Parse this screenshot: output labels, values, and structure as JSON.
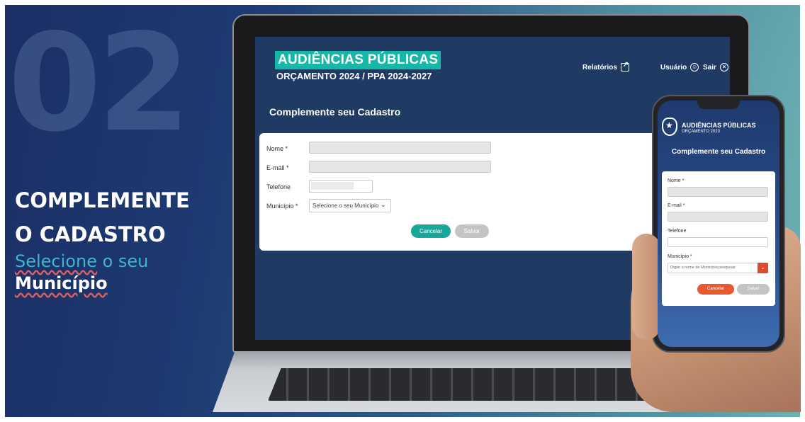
{
  "slide": {
    "number": "02",
    "heading_line1": "COMPLEMENTE",
    "heading_line2": "O CADASTRO",
    "sub_word1": "Selecione",
    "sub_rest": " o seu",
    "sub_line2": "Município"
  },
  "desktop": {
    "logo_title": "AUDIÊNCIAS PÚBLICAS",
    "logo_subtitle": "ORÇAMENTO 2024 / PPA 2024-2027",
    "nav": {
      "reports_label": "Relatórios",
      "user_label": "Usuário",
      "logout_label": "Sair"
    },
    "form_title": "Complemente seu Cadastro",
    "fields": {
      "name_label": "Nome *",
      "email_label": "E-mail *",
      "phone_label": "Telefone",
      "municipality_label": "Município *",
      "municipality_selected": "Selecione o seu Município"
    },
    "buttons": {
      "cancel": "Cancelar",
      "save": "Salvar"
    }
  },
  "mobile": {
    "logo_title": "AUDIÊNCIAS PÚBLICAS",
    "logo_subtitle": "ORÇAMENTO 2023",
    "form_title": "Complemente seu Cadastro",
    "fields": {
      "name_label": "Nome *",
      "email_label": "E-mail *",
      "phone_label": "Telefone",
      "municipality_label": "Município *",
      "municipality_placeholder": "Digite o nome do Município pesquisar"
    },
    "buttons": {
      "cancel": "Cancelar",
      "save": "Salvar"
    }
  },
  "colors": {
    "teal_accent": "#17b7a8",
    "orange_accent": "#e04a2a",
    "disabled_gray": "#c4c4c4"
  }
}
